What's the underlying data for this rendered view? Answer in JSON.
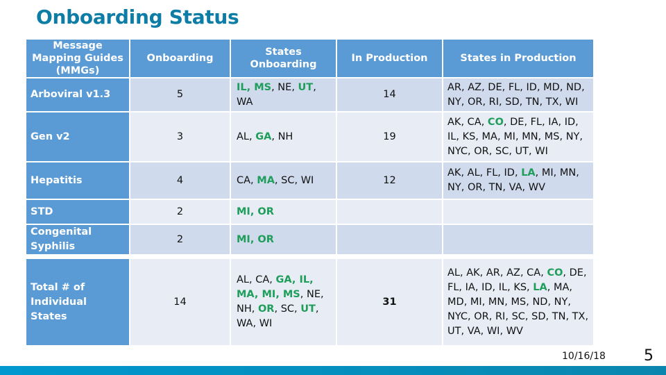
{
  "slide": {
    "title": "Onboarding Status",
    "date": "10/16/18",
    "page_number": "5",
    "colors": {
      "title": "#0E7DA6",
      "header_bg": "#5B9BD5",
      "row_odd_bg": "#CFDAEC",
      "row_even_bg": "#E8ECF5",
      "highlight_state": "#1E9E5A",
      "bottom_bar": "#0098CE"
    }
  },
  "table": {
    "headers": [
      "Message Mapping Guides (MMGs)",
      "Onboarding",
      "States Onboarding",
      "In Production",
      "States in Production"
    ],
    "rows": [
      {
        "mmg": "Arboviral v1.3",
        "onboarding": "5",
        "states_onboarding": [
          {
            "s": "IL",
            "hl": true
          },
          {
            "s": "MS",
            "hl": true
          },
          {
            "s": "NE",
            "hl": false
          },
          {
            "s": "UT",
            "hl": true
          },
          {
            "s": "WA",
            "hl": false
          }
        ],
        "in_production": "14",
        "states_in_production": [
          {
            "s": "AR",
            "hl": false
          },
          {
            "s": "AZ",
            "hl": false
          },
          {
            "s": "DE",
            "hl": false
          },
          {
            "s": "FL",
            "hl": false
          },
          {
            "s": "ID",
            "hl": false
          },
          {
            "s": "MD",
            "hl": false
          },
          {
            "s": "ND",
            "hl": false
          },
          {
            "s": "NY",
            "hl": false
          },
          {
            "s": "OR",
            "hl": false
          },
          {
            "s": "RI",
            "hl": false
          },
          {
            "s": "SD",
            "hl": false
          },
          {
            "s": "TN",
            "hl": false
          },
          {
            "s": "TX",
            "hl": false
          },
          {
            "s": "WI",
            "hl": false
          }
        ]
      },
      {
        "mmg": "Gen v2",
        "onboarding": "3",
        "states_onboarding": [
          {
            "s": "AL",
            "hl": false
          },
          {
            "s": "GA",
            "hl": true
          },
          {
            "s": "NH",
            "hl": false
          }
        ],
        "in_production": "19",
        "states_in_production": [
          {
            "s": "AK",
            "hl": false
          },
          {
            "s": "CA",
            "hl": false
          },
          {
            "s": "CO",
            "hl": true
          },
          {
            "s": "DE",
            "hl": false
          },
          {
            "s": "FL",
            "hl": false
          },
          {
            "s": "IA",
            "hl": false
          },
          {
            "s": "ID",
            "hl": false
          },
          {
            "s": "IL",
            "hl": false
          },
          {
            "s": "KS",
            "hl": false
          },
          {
            "s": "MA",
            "hl": false
          },
          {
            "s": "MI",
            "hl": false
          },
          {
            "s": "MN",
            "hl": false
          },
          {
            "s": "MS",
            "hl": false
          },
          {
            "s": "NY",
            "hl": false
          },
          {
            "s": "NYC",
            "hl": false
          },
          {
            "s": "OR",
            "hl": false
          },
          {
            "s": "SC",
            "hl": false
          },
          {
            "s": "UT",
            "hl": false
          },
          {
            "s": "WI",
            "hl": false
          }
        ]
      },
      {
        "mmg": "Hepatitis",
        "onboarding": "4",
        "states_onboarding": [
          {
            "s": "CA",
            "hl": false
          },
          {
            "s": "MA",
            "hl": true
          },
          {
            "s": "SC",
            "hl": false
          },
          {
            "s": "WI",
            "hl": false
          }
        ],
        "in_production": "12",
        "states_in_production": [
          {
            "s": "AK",
            "hl": false
          },
          {
            "s": "AL",
            "hl": false
          },
          {
            "s": "FL",
            "hl": false
          },
          {
            "s": "ID",
            "hl": false
          },
          {
            "s": "LA",
            "hl": true
          },
          {
            "s": "MI",
            "hl": false
          },
          {
            "s": "MN",
            "hl": false
          },
          {
            "s": "NY",
            "hl": false
          },
          {
            "s": "OR",
            "hl": false
          },
          {
            "s": "TN",
            "hl": false
          },
          {
            "s": "VA",
            "hl": false
          },
          {
            "s": "WV",
            "hl": false
          }
        ]
      },
      {
        "mmg": "STD",
        "onboarding": "2",
        "states_onboarding": [
          {
            "s": "MI",
            "hl": true
          },
          {
            "s": "OR",
            "hl": true
          }
        ],
        "in_production": "",
        "states_in_production": []
      },
      {
        "mmg": "Congenital Syphilis",
        "onboarding": "2",
        "states_onboarding": [
          {
            "s": "MI",
            "hl": true
          },
          {
            "s": "OR",
            "hl": true
          }
        ],
        "in_production": "",
        "states_in_production": []
      }
    ],
    "total": {
      "label": "Total # of Individual States",
      "onboarding": "14",
      "states_onboarding": [
        {
          "s": "AL",
          "hl": false
        },
        {
          "s": "CA",
          "hl": false
        },
        {
          "s": "GA",
          "hl": true
        },
        {
          "s": "IL",
          "hl": true
        },
        {
          "s": "MA",
          "hl": true
        },
        {
          "s": "MI",
          "hl": true
        },
        {
          "s": "MS",
          "hl": true
        },
        {
          "s": "NE",
          "hl": false
        },
        {
          "s": "NH",
          "hl": false
        },
        {
          "s": "OR",
          "hl": true
        },
        {
          "s": "SC",
          "hl": false
        },
        {
          "s": "UT",
          "hl": true
        },
        {
          "s": "WA",
          "hl": false
        },
        {
          "s": "WI",
          "hl": false
        }
      ],
      "in_production": "31",
      "states_in_production": [
        {
          "s": "AL",
          "hl": false
        },
        {
          "s": "AK",
          "hl": false
        },
        {
          "s": "AR",
          "hl": false
        },
        {
          "s": "AZ",
          "hl": false
        },
        {
          "s": "CA",
          "hl": false
        },
        {
          "s": "CO",
          "hl": true
        },
        {
          "s": "DE",
          "hl": false
        },
        {
          "s": "FL",
          "hl": false
        },
        {
          "s": "IA",
          "hl": false
        },
        {
          "s": "ID",
          "hl": false
        },
        {
          "s": "IL",
          "hl": false
        },
        {
          "s": "KS",
          "hl": false
        },
        {
          "s": "LA",
          "hl": true
        },
        {
          "s": "MA",
          "hl": false
        },
        {
          "s": "MD",
          "hl": false
        },
        {
          "s": "MI",
          "hl": false
        },
        {
          "s": "MN",
          "hl": false
        },
        {
          "s": "MS",
          "hl": false
        },
        {
          "s": "ND",
          "hl": false
        },
        {
          "s": "NY",
          "hl": false
        },
        {
          "s": "NYC",
          "hl": false
        },
        {
          "s": "OR",
          "hl": false
        },
        {
          "s": "RI",
          "hl": false
        },
        {
          "s": "SC",
          "hl": false
        },
        {
          "s": "SD",
          "hl": false
        },
        {
          "s": "TN",
          "hl": false
        },
        {
          "s": "TX",
          "hl": false
        },
        {
          "s": "UT",
          "hl": false
        },
        {
          "s": "VA",
          "hl": false
        },
        {
          "s": "WI",
          "hl": false
        },
        {
          "s": "WV",
          "hl": false
        }
      ]
    }
  }
}
